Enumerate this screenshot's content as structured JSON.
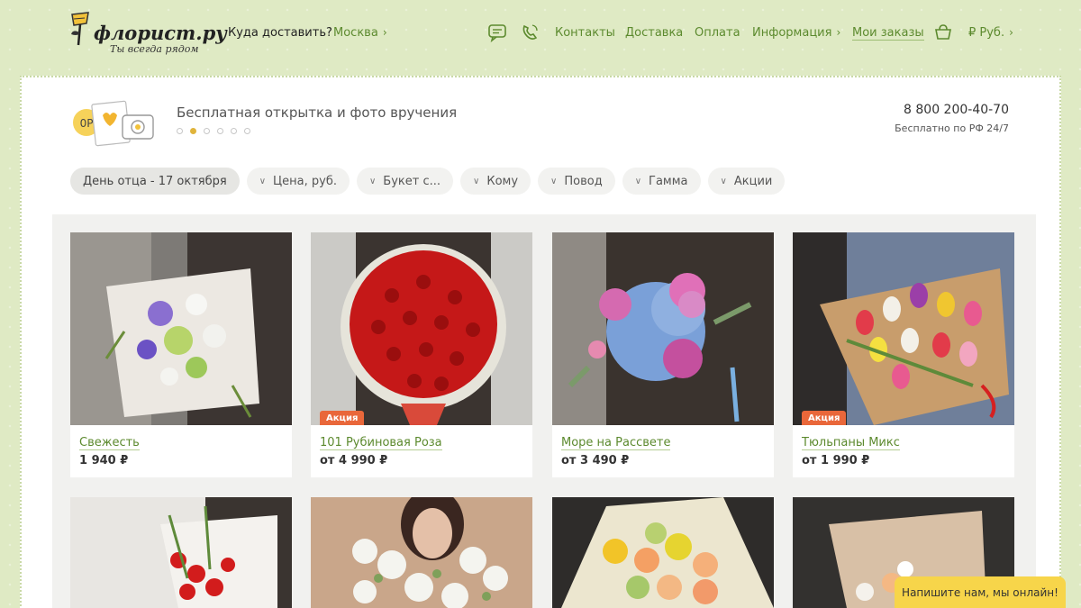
{
  "brand": {
    "name": "флорист.ру",
    "tagline": "Ты всегда рядом"
  },
  "header": {
    "deliver_question": "Куда доставить?",
    "city": "Москва",
    "nav": {
      "contacts": "Контакты",
      "delivery": "Доставка",
      "payment": "Оплата",
      "info": "Информация",
      "orders": "Мои заказы",
      "currency": "₽ Руб."
    }
  },
  "promo": {
    "badge_text": "0Р",
    "text": "Бесплатная открытка и фото вручения",
    "slides_total": 6,
    "active_slide": 2
  },
  "contact": {
    "phone": "8 800 200-40-70",
    "phone_note": "Бесплатно по РФ 24/7"
  },
  "filters": [
    "День отца - 17 октября",
    "Цена, руб.",
    "Букет с...",
    "Кому",
    "Повод",
    "Гамма",
    "Акции"
  ],
  "products": [
    {
      "title": "Свежесть",
      "price": "1 940 ₽",
      "badge": ""
    },
    {
      "title": "101 Рубиновая Роза",
      "price": "от 4 990 ₽",
      "badge": "Акция"
    },
    {
      "title": "Море на Рассвете",
      "price": "от 3 490 ₽",
      "badge": ""
    },
    {
      "title": "Тюльпаны Микс",
      "price": "от 1 990 ₽",
      "badge": "Акция"
    }
  ],
  "chat": {
    "label": "Напишите нам, мы онлайн!"
  },
  "colors": {
    "accent_green": "#5c8a2e",
    "page_bg": "#dfeac4",
    "badge": "#e9673a",
    "chat": "#f7d54a",
    "dot_active": "#e0b43c"
  },
  "icons": [
    "logo-flower-icon",
    "chat-icon",
    "phone-leaf-icon",
    "cart-icon",
    "chevron-right-icon",
    "chevron-down-icon"
  ]
}
